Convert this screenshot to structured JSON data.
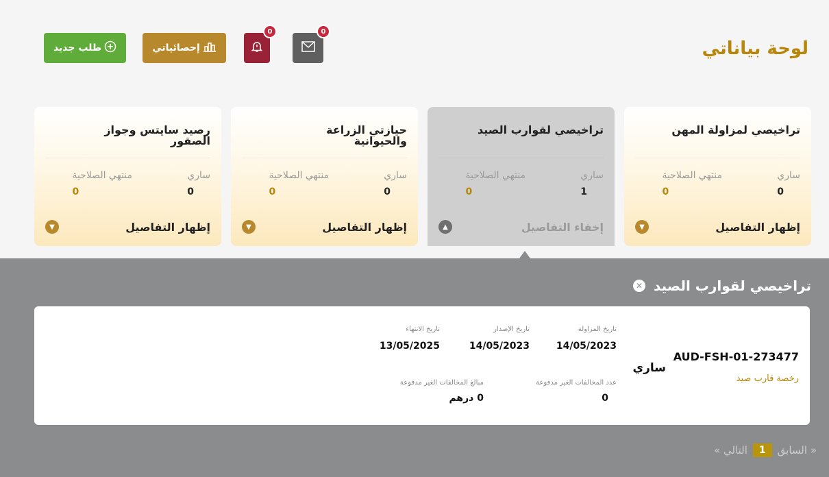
{
  "header": {
    "page_title": "لوحة بياناتي",
    "new_request_label": "طلب جديد",
    "stats_label": "إحصائياتي",
    "notifications_count": "0",
    "messages_count": "0"
  },
  "cards": [
    {
      "title": "تراخيصي لمزاولة المهن",
      "active_label": "ساري",
      "expired_label": "منتهي الصلاحية",
      "active_count": "0",
      "expired_count": "0",
      "toggle_label": "إظهار التفاصيل"
    },
    {
      "title": "تراخيصي لقوارب الصيد",
      "active_label": "ساري",
      "expired_label": "منتهي الصلاحية",
      "active_count": "1",
      "expired_count": "0",
      "toggle_label": "إخفاء التفاصيل"
    },
    {
      "title": "حيازتي الزراعة والحيوانية",
      "active_label": "ساري",
      "expired_label": "منتهي الصلاحية",
      "active_count": "0",
      "expired_count": "0",
      "toggle_label": "إظهار التفاصيل"
    },
    {
      "title": "رصيد سايتس وجواز الصقور",
      "active_label": "ساري",
      "expired_label": "منتهي الصلاحية",
      "active_count": "0",
      "expired_count": "0",
      "toggle_label": "إظهار التفاصيل"
    }
  ],
  "details": {
    "title": "تراخيصي لقوارب الصيد",
    "license": {
      "number": "AUD-FSH-01-273477",
      "type": "رخصة قارب صيد",
      "status": "ساري",
      "practice_date_label": "تاريخ المزاولة",
      "practice_date": "14/05/2023",
      "issue_date_label": "تاريخ الإصدار",
      "issue_date": "14/05/2023",
      "expiry_date_label": "تاريخ الانتهاء",
      "expiry_date": "13/05/2025",
      "unpaid_violations_label": "عدد المخالفات الغير مدفوعة",
      "unpaid_violations": "0",
      "unpaid_amount_label": "مبالغ المخالفات الغير مدفوعة",
      "unpaid_amount": "0 درهم"
    }
  },
  "pagination": {
    "prev_label": "« السابق",
    "current_page": "1",
    "next_label": "التالي »"
  }
}
